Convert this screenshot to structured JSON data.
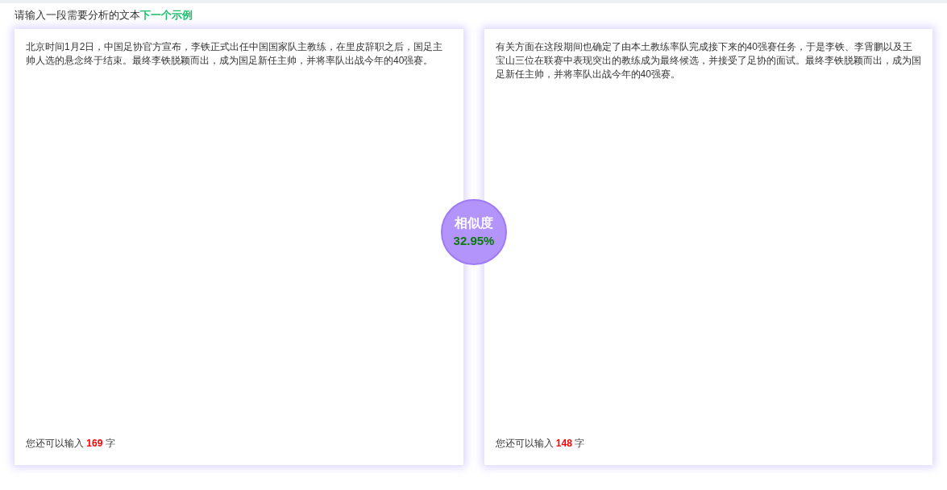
{
  "prompt": {
    "label": "请输入一段需要分析的文本",
    "link": "下一个示例"
  },
  "panels": [
    {
      "text": "北京时间1月2日，中国足协官方宣布，李铁正式出任中国国家队主教练，在里皮辞职之后，国足主帅人选的悬念终于结束。最终李铁脱颖而出，成为国足新任主帅，并将率队出战今年的40强赛。",
      "counter_prefix": "您还可以输入",
      "counter_value": "169",
      "counter_suffix": "字"
    },
    {
      "text": "有关方面在这段期间也确定了由本土教练率队完成接下来的40强赛任务，于是李铁、李霄鹏以及王宝山三位在联赛中表现突出的教练成为最终候选，并接受了足协的面试。最终李铁脱颖而出，成为国足新任主帅，并将率队出战今年的40强赛。",
      "counter_prefix": "您还可以输入",
      "counter_value": "148",
      "counter_suffix": "字"
    }
  ],
  "similarity": {
    "label": "相似度",
    "value": "32.95%"
  }
}
